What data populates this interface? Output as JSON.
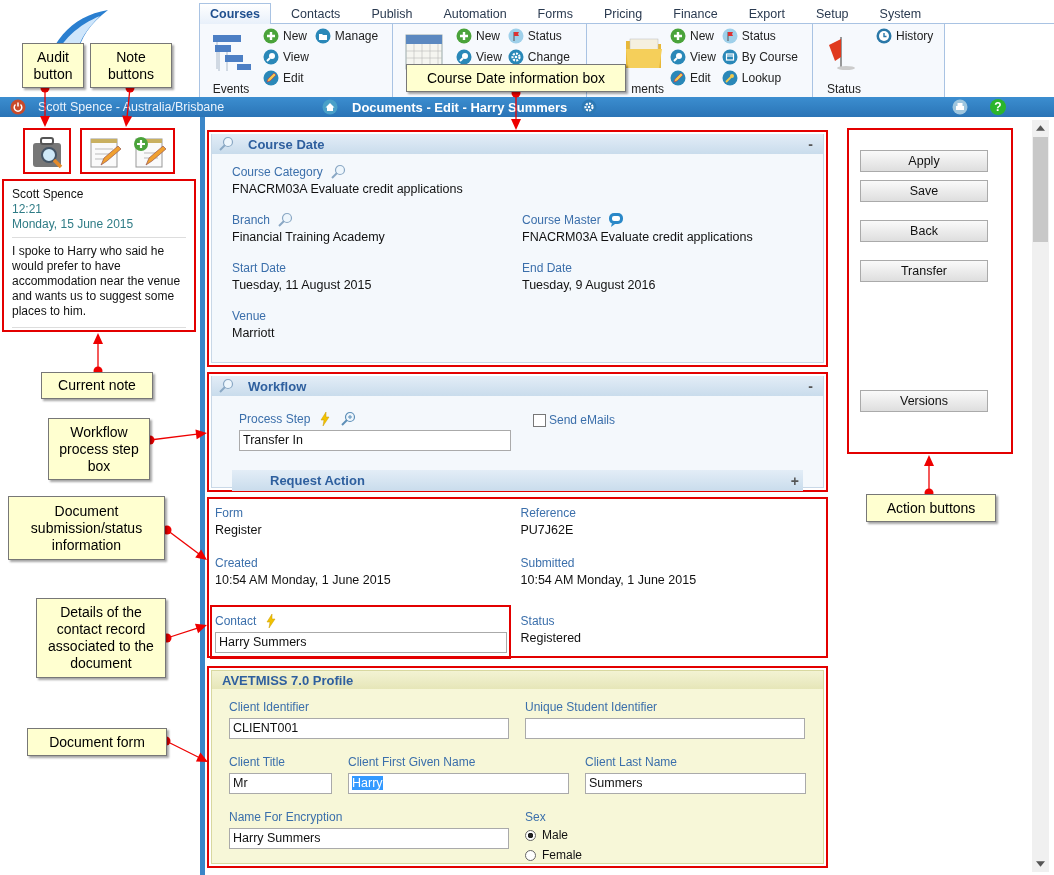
{
  "ribbon": {
    "tabs": [
      {
        "label": "Courses",
        "selected": true
      },
      {
        "label": "Contacts",
        "selected": false
      },
      {
        "label": "Publish",
        "selected": false
      },
      {
        "label": "Automation",
        "selected": false
      },
      {
        "label": "Forms",
        "selected": false
      },
      {
        "label": "Pricing",
        "selected": false
      },
      {
        "label": "Finance",
        "selected": false
      },
      {
        "label": "Export",
        "selected": false
      },
      {
        "label": "Setup",
        "selected": false
      },
      {
        "label": "System",
        "selected": false
      }
    ],
    "groups": [
      {
        "large": {
          "kind": "events",
          "label": "Events"
        },
        "columns": [
          [
            {
              "kind": "new",
              "label": "New"
            },
            {
              "kind": "view",
              "label": "View"
            },
            {
              "kind": "edit",
              "label": "Edit"
            }
          ],
          [
            {
              "kind": "manage",
              "label": "Manage"
            }
          ]
        ]
      },
      {
        "large": {
          "kind": "calendar"
        },
        "columns": [
          [
            {
              "kind": "new",
              "label": "New"
            },
            {
              "kind": "view",
              "label": "View"
            }
          ],
          [
            {
              "kind": "status",
              "label": "Status"
            },
            {
              "kind": "change",
              "label": "Change"
            }
          ]
        ]
      },
      {
        "large": {
          "kind": "folder",
          "label": "ments"
        },
        "columns": [
          [
            {
              "kind": "new",
              "label": "New"
            },
            {
              "kind": "view",
              "label": "View"
            },
            {
              "kind": "edit",
              "label": "Edit"
            }
          ],
          [
            {
              "kind": "status",
              "label": "Status"
            },
            {
              "kind": "bycourse",
              "label": "By Course"
            },
            {
              "kind": "lookup",
              "label": "Lookup"
            }
          ]
        ]
      },
      {
        "large": {
          "kind": "flag",
          "label": "Status"
        },
        "columns": [
          [
            {
              "kind": "history",
              "label": "History"
            }
          ]
        ]
      }
    ]
  },
  "title_bar": {
    "user": "Scott Spence - Australia/Brisbane",
    "title": "Documents - Edit - Harry Summers",
    "help": "?"
  },
  "note": {
    "author": "Scott Spence",
    "time": "12:21",
    "date": "Monday, 15 June 2015",
    "text": "I spoke to Harry who said he would prefer to have accommodation near the venue and wants us to suggest some places to him."
  },
  "course_date": {
    "title": "Course Date",
    "collapse": "-",
    "rows": [
      [
        {
          "label": "Course Category",
          "value": "FNACRM03A Evaluate credit applications"
        }
      ],
      [
        {
          "label": "Branch",
          "value": "Financial Training Academy"
        },
        {
          "label": "Course Master",
          "value": "FNACRM03A Evaluate credit applications"
        }
      ],
      [
        {
          "label": "Start Date",
          "value": "Tuesday, 11 August 2015"
        },
        {
          "label": "End Date",
          "value": "Tuesday, 9 August 2016"
        }
      ],
      [
        {
          "label": "Venue",
          "value": "Marriott"
        }
      ]
    ]
  },
  "workflow": {
    "title": "Workflow",
    "collapse": "-",
    "process_step": {
      "label": "Process Step",
      "value": "Transfer In"
    },
    "send_emails": {
      "label": "Send eMails",
      "checked": false
    },
    "request_action": {
      "label": "Request Action",
      "expand": "+"
    }
  },
  "document": {
    "rows": [
      [
        {
          "label": "Form",
          "value": "Register"
        },
        {
          "label": "Reference",
          "value": "PU7J62E"
        }
      ],
      [
        {
          "label": "Created",
          "value": "10:54 AM Monday, 1 June 2015"
        },
        {
          "label": "Submitted",
          "value": "10:54 AM Monday, 1 June 2015"
        }
      ]
    ],
    "contact": {
      "label": "Contact",
      "value": "Harry Summers"
    },
    "status": {
      "label": "Status",
      "value": "Registered"
    }
  },
  "profile": {
    "title": "AVETMISS 7.0 Profile",
    "lines": [
      {
        "fields": [
          {
            "label": "Client Identifier",
            "value": "CLIENT001",
            "text_selected": false
          },
          {
            "label": "Unique Student Identifier"
          }
        ]
      },
      {
        "fields": [
          {
            "label": "Client Title",
            "value": "Mr",
            "text_selected": false
          },
          {
            "label": "Client First Given Name",
            "value": "Harry",
            "text_selected": true
          },
          {
            "label": "Client Last Name",
            "value": "Summers",
            "text_selected": false
          }
        ]
      },
      {
        "fields": [
          {
            "label": "Name For Encryption",
            "value": "Harry Summers",
            "text_selected": false
          }
        ]
      }
    ],
    "sex": {
      "label": "Sex",
      "options": [
        {
          "label": "Male",
          "selected": true
        },
        {
          "label": "Female",
          "selected": false
        }
      ]
    }
  },
  "actions": [
    "Apply",
    "Save",
    "Back",
    "Transfer",
    "Versions"
  ],
  "callouts": [
    {
      "text": "Audit button"
    },
    {
      "text": "Note buttons"
    },
    {
      "text": "Course Date information box"
    },
    {
      "text": "Current note"
    },
    {
      "text": "Workflow process step box"
    },
    {
      "text": "Document submission/status information"
    },
    {
      "text": "Details of the contact record associated to the document"
    },
    {
      "text": "Document form"
    },
    {
      "text": "Action buttons"
    }
  ]
}
